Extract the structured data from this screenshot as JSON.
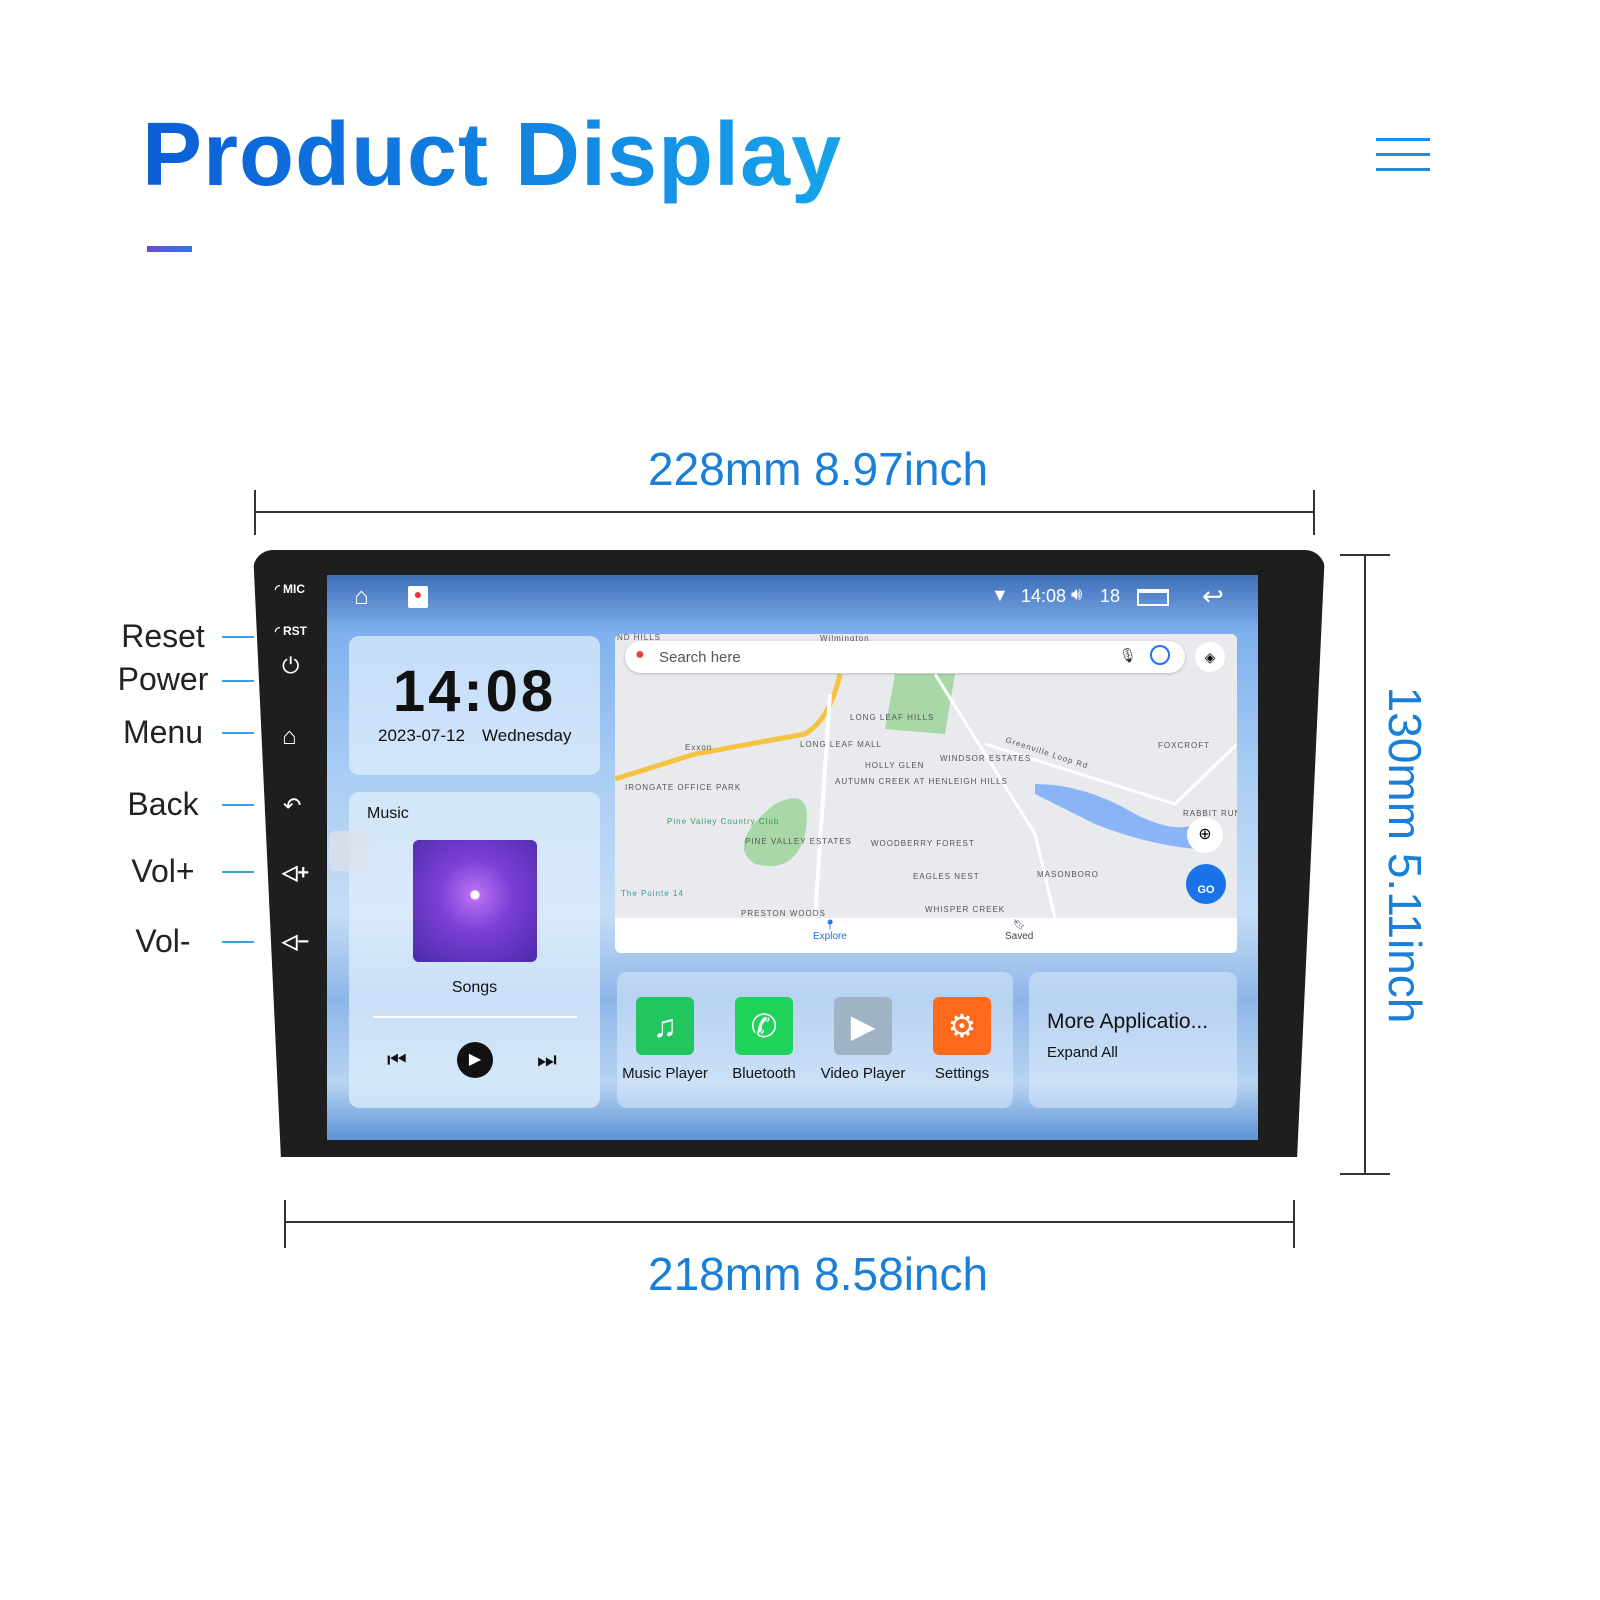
{
  "header": {
    "title": "Product Display",
    "menu_icon": "hamburger-icon"
  },
  "dimensions": {
    "top": "228mm 8.97inch",
    "bottom": "218mm 8.58inch",
    "right": "130mm 5.11inch"
  },
  "side_labels": [
    "Reset",
    "Power",
    "Menu",
    "Back",
    "Vol+",
    "Vol-"
  ],
  "bezel": {
    "mic": "MIC",
    "rst": "RST"
  },
  "status_bar": {
    "time": "14:08",
    "volume": "18"
  },
  "clock": {
    "time": "14:08",
    "date": "2023-07-12",
    "weekday": "Wednesday"
  },
  "music": {
    "title": "Music",
    "song": "Songs"
  },
  "map": {
    "search_placeholder": "Search here",
    "tabs": [
      "Explore",
      "Saved"
    ],
    "go_label": "GO",
    "places": [
      "ND HILLS",
      "Wilmington",
      "Exxon",
      "LONG LEAF HILLS",
      "LONG LEAF MALL",
      "HOLLY GLEN",
      "WINDSOR ESTATES",
      "FOXCROFT",
      "IRONGATE OFFICE PARK",
      "AUTUMN CREEK AT HENLEIGH HILLS",
      "Pine Valley Country Club",
      "PINE VALLEY ESTATES",
      "WOODBERRY FOREST",
      "EAGLES NEST",
      "MASONBORO",
      "WHISPER CREEK",
      "PRESTON WOODS",
      "The Pointe 14",
      "RABBIT RUN",
      "Greenville Loop Rd"
    ]
  },
  "apps": [
    {
      "label": "Music Player",
      "color": "#22c55e"
    },
    {
      "label": "Bluetooth",
      "color": "#1fd25a"
    },
    {
      "label": "Video Player",
      "color": "#9fb3c4"
    },
    {
      "label": "Settings",
      "color": "#ff6a1a"
    }
  ],
  "more_apps": {
    "title": "More Applicatio...",
    "subtitle": "Expand All"
  },
  "colors": {
    "accent": "#1a7fd6",
    "go_button": "#1a73e8"
  }
}
